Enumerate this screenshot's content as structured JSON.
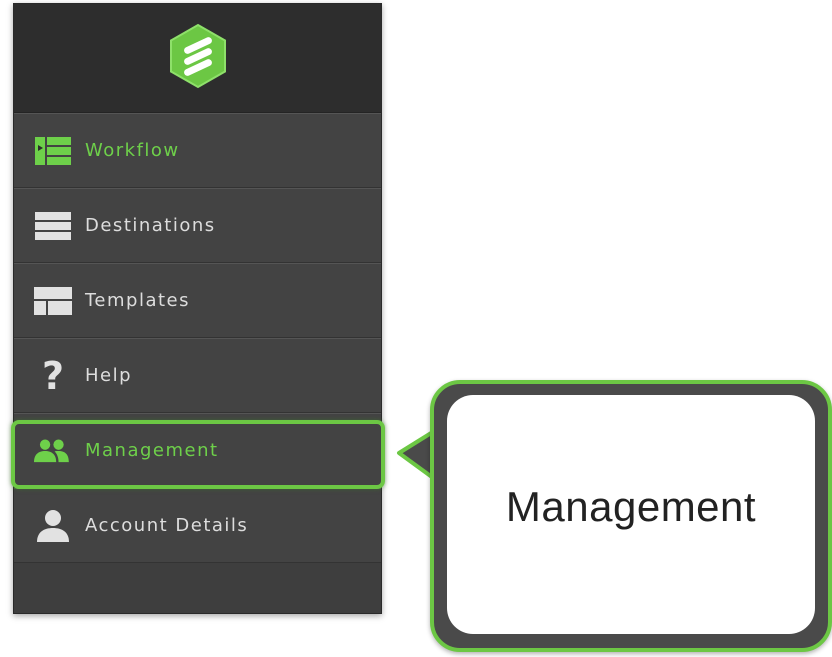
{
  "colors": {
    "accent": "#6cc744",
    "active_text": "#6ed04a",
    "sidebar_bg": "#434343",
    "header_bg": "#2d2d2d",
    "text": "#dddddd"
  },
  "sidebar": {
    "logo_icon": "brand-hexagon-logo-icon",
    "items": [
      {
        "label": "Workflow",
        "icon": "workflow-icon",
        "active": true
      },
      {
        "label": "Destinations",
        "icon": "list-icon",
        "active": false
      },
      {
        "label": "Templates",
        "icon": "layout-icon",
        "active": false
      },
      {
        "label": "Help",
        "icon": "question-icon",
        "active": false
      },
      {
        "label": "Management",
        "icon": "users-icon",
        "active": false,
        "highlighted": true
      },
      {
        "label": "Account Details",
        "icon": "user-icon",
        "active": false
      }
    ]
  },
  "callout": {
    "text": "Management"
  }
}
